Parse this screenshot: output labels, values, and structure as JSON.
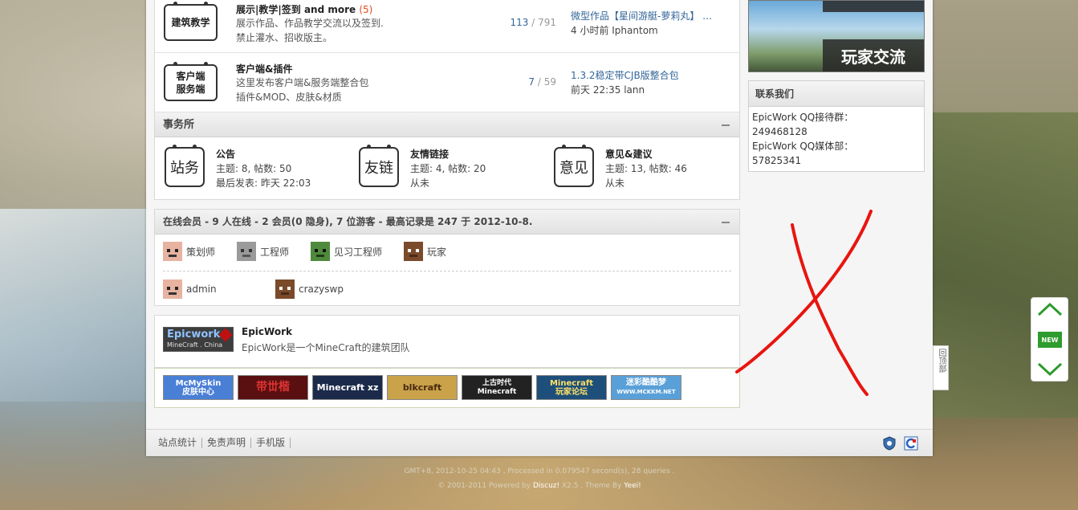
{
  "forums": [
    {
      "icon_label": "建筑教学",
      "name": "展示|教学|签到 and more",
      "new_count": "(5)",
      "desc1": "展示作品、作品教学交流以及签到.",
      "desc2": "禁止灌水、招收版主。",
      "threads": "113",
      "sep": " / ",
      "posts": "791",
      "last_title": "微型作品【星间游艇-萝莉丸】 …",
      "last_meta": "4 小时前 Iphantom"
    },
    {
      "icon_label": "客户端\n服务端",
      "icon_line1": "客户端",
      "icon_line2": "服务端",
      "name": "客户端&插件",
      "desc1": "这里发布客户端&服务端整合包",
      "desc2": "插件&MOD、皮肤&材质",
      "threads": "7",
      "sep": " / ",
      "posts": "59",
      "last_title": "1.3.2稳定带CJB版整合包",
      "last_meta": "前天 22:35 lann"
    }
  ],
  "office": {
    "title": "事务所",
    "items": [
      {
        "icon": "站务",
        "name": "公告",
        "line1": "主题: 8, 帖数: 50",
        "line2": "最后发表: 昨天 22:03"
      },
      {
        "icon": "友链",
        "name": "友情链接",
        "line1": "主题: 4, 帖数: 20",
        "line2": "从未"
      },
      {
        "icon": "意见",
        "name": "意见&建议",
        "line1": "主题: 13, 帖数: 46",
        "line2": "从未"
      }
    ]
  },
  "online": {
    "title": "在线会员 - 9 人在线 - 2 会员(0 隐身), 7 位游客 - 最高记录是 247 于 2012-10-8.",
    "legend": [
      "策划师",
      "工程师",
      "见习工程师",
      "玩家"
    ],
    "members": [
      "admin",
      "crazyswp"
    ]
  },
  "team": {
    "logo_top": "Epicwork",
    "logo_bottom": "MineCraft . China",
    "name": "EpicWork",
    "desc": "EpicWork是一个MineCraft的建筑团队"
  },
  "links": [
    {
      "label": "McMySkin\n皮肤中心",
      "l1": "McMySkin",
      "l2": "皮肤中心",
      "color": "#4a7fd6"
    },
    {
      "label": "带世楷",
      "l1": "带丗楷",
      "l2": "",
      "color": "#5a1010"
    },
    {
      "label": "Minecraft xz",
      "l1": "Minecraft xz",
      "l2": "",
      "color": "#1b2a4a"
    },
    {
      "label": "blkcraft",
      "l1": "blkcraft",
      "l2": "",
      "color": "#c9a24a"
    },
    {
      "label": "上古时代 Minecraft",
      "l1": "上古时代",
      "l2": "Minecraft",
      "color": "#222222"
    },
    {
      "label": "Minecraft 玩家论坛",
      "l1": "Minecraft",
      "l2": "玩家论坛",
      "color": "#1d4f7a"
    },
    {
      "label": "迷彩酷酷梦",
      "l1": "迷彩酷酷梦",
      "l2": "WWW.MCKKM.NET",
      "color": "#5aa0d8"
    }
  ],
  "sidebar": {
    "banner_label": "玩家交流",
    "contact_title": "联系我们",
    "contact_lines": [
      "EpicWork QQ接待群：",
      "249468128",
      "EpicWork QQ媒体部：",
      "57825341"
    ]
  },
  "footer": {
    "links": [
      "站点统计",
      "免责声明",
      "手机版"
    ],
    "line1": "GMT+8, 2012-10-25 04:43 , Processed in 0.079547 second(s), 28 queries .",
    "line2_a": "© 2001-2011 Powered by ",
    "line2_b": "Discuz!",
    "line2_c": " X2.5 . Theme By ",
    "line2_d": "Yeei!"
  },
  "backtop": "回顶部",
  "new_badge": "NEW",
  "colors": {
    "accent_link": "#336699",
    "new_count": "#e04a1b",
    "annotation_red": "#e8150f",
    "new_green": "#2e9b2e"
  }
}
